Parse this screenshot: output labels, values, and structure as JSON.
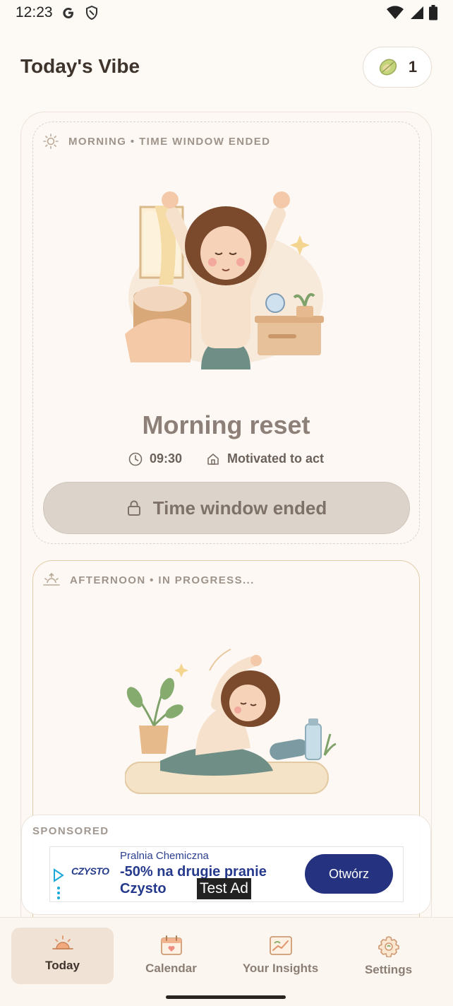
{
  "status_bar": {
    "time": "12:23"
  },
  "header": {
    "title": "Today's Vibe",
    "coin_count": "1"
  },
  "morning": {
    "slot_label": "MORNING • TIME WINDOW ENDED",
    "title": "Morning reset",
    "time": "09:30",
    "mood": "Motivated to act",
    "button_label": "Time window ended"
  },
  "afternoon": {
    "slot_label": "AFTERNOON • IN PROGRESS..."
  },
  "ad": {
    "sponsored_label": "SPONSORED",
    "brand": "CZYSTO",
    "advertiser": "Pralnia Chemiczna",
    "headline": "-50% na drugie pranie Czysto",
    "cta": "Otwórz",
    "test_tag": "Test Ad"
  },
  "nav": {
    "items": [
      {
        "label": "Today",
        "icon": "sunrise-icon"
      },
      {
        "label": "Calendar",
        "icon": "calendar-icon"
      },
      {
        "label": "Your Insights",
        "icon": "insights-chart-icon"
      },
      {
        "label": "Settings",
        "icon": "gear-icon"
      }
    ]
  }
}
